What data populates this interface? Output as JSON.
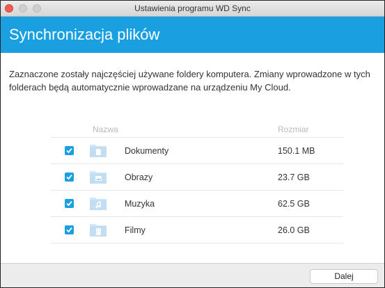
{
  "window": {
    "title": "Ustawienia programu WD Sync"
  },
  "header": {
    "title": "Synchronizacja plików",
    "accent_color": "#1aa0e0"
  },
  "intro": {
    "text": "Zaznaczone zostały najczęściej używane foldery komputera. Zmiany wprowadzone w tych folderach będą automatycznie wprowadzane na urządzeniu My Cloud."
  },
  "table": {
    "columns": {
      "name": "Nazwa",
      "size": "Rozmiar"
    },
    "rows": [
      {
        "checked": true,
        "icon": "document-folder-icon",
        "name": "Dokumenty",
        "size": "150.1 MB"
      },
      {
        "checked": true,
        "icon": "image-folder-icon",
        "name": "Obrazy",
        "size": "23.7 GB"
      },
      {
        "checked": true,
        "icon": "music-folder-icon",
        "name": "Muzyka",
        "size": "62.5 GB"
      },
      {
        "checked": true,
        "icon": "film-folder-icon",
        "name": "Filmy",
        "size": "26.0 GB"
      }
    ]
  },
  "footer": {
    "next_label": "Dalej"
  }
}
